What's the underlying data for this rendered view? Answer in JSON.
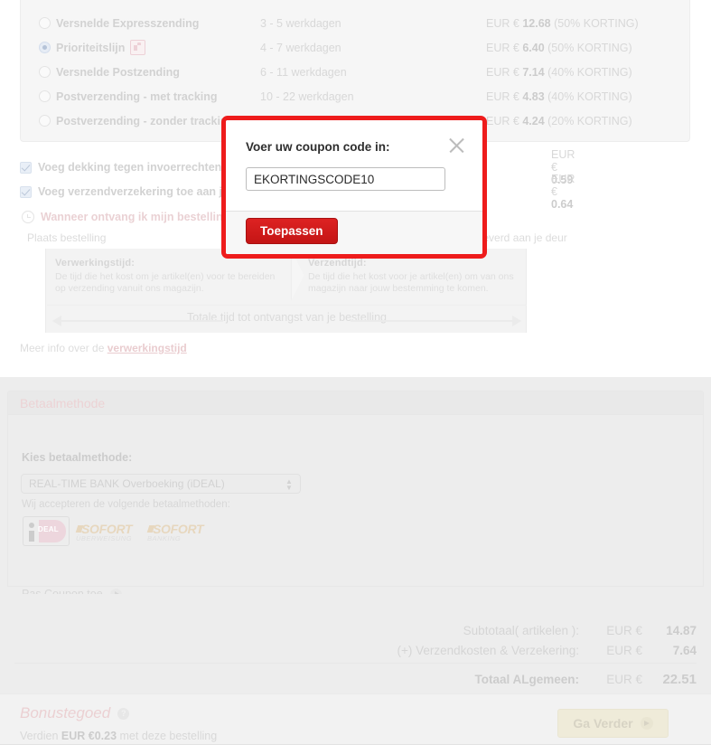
{
  "shipping": {
    "options": [
      {
        "name": "Versnelde Expresszending",
        "selected": false,
        "badge": false,
        "days": "3 - 5 werkdagen",
        "currency": "EUR €",
        "price": "12.68",
        "discount": "(50% KORTING)"
      },
      {
        "name": "Prioriteitslijn",
        "selected": true,
        "badge": true,
        "days": "4 - 7 werkdagen",
        "currency": "EUR €",
        "price": "6.40",
        "discount": "(50% KORTING)"
      },
      {
        "name": "Versnelde Postzending",
        "selected": false,
        "badge": false,
        "days": "6 - 11 werkdagen",
        "currency": "EUR €",
        "price": "7.14",
        "discount": "(40% KORTING)"
      },
      {
        "name": "Postverzending - met tracking",
        "selected": false,
        "badge": false,
        "days": "10 - 22 werkdagen",
        "currency": "EUR €",
        "price": "4.83",
        "discount": "(40% KORTING)"
      },
      {
        "name": "Postverzending - zonder tracking",
        "selected": false,
        "badge": false,
        "days": "",
        "currency": "EUR €",
        "price": "4.24",
        "discount": "(20% KORTING)"
      }
    ],
    "addons": [
      {
        "label": "Voeg dekking tegen invoerrechten &",
        "checked": true,
        "currency": "EUR €",
        "price": "0.59"
      },
      {
        "label": "Voeg verzendverzekering toe aan je",
        "checked": true,
        "currency": "EUR €",
        "price": "0.64"
      }
    ],
    "when_question": "Wanneer ontvang ik mijn bestelling?"
  },
  "timeline": {
    "start_label": "Plaats bestelling",
    "end_label": "eleverd aan je deur",
    "processing": {
      "title": "Verwerkingstijd:",
      "text": "De tijd die het kost om je artikel(en) voor te bereiden op verzending vanuit ons magazijn."
    },
    "shipping_time": {
      "title": "Verzendtijd:",
      "text": "De tijd die het kost voor je artikel(en) om van ons magazijn naar jouw bestemming te komen."
    },
    "total_label": "Totale tijd tot ontvangst van je bestelling",
    "more_info_prefix": "Meer info over de ",
    "more_info_link": "verwerkingstijd"
  },
  "payment": {
    "section_title": "Betaalmethode",
    "choose_label": "Kies betaalmethode:",
    "selected_method": "REAL-TIME BANK Overboeking (iDEAL)",
    "accepted_label": "Wij accepteren de volgende betaalmethoden:",
    "logos": [
      {
        "name": "ideal",
        "text": "DEAL"
      },
      {
        "name": "sofort-uberweisung",
        "big": "SOFORT",
        "small": "ÜBERWEISUNG"
      },
      {
        "name": "sofort-banking",
        "big": "SOFORT",
        "small": "BANKING"
      }
    ],
    "coupon_link": "Pas Coupon toe"
  },
  "totals": {
    "rows": [
      {
        "label": "Subtotaal( artikelen ):",
        "currency": "EUR €",
        "amount": "14.87"
      },
      {
        "label": "(+) Verzendkosten & Verzekering:",
        "currency": "EUR €",
        "amount": "7.64"
      }
    ],
    "grand": {
      "label": "Totaal ALgemeen:",
      "currency": "EUR €",
      "amount": "22.51"
    }
  },
  "bonus": {
    "title": "Bonustegoed",
    "help": "?",
    "sub_prefix": "Verdien ",
    "sub_amount": "EUR €0.23",
    "sub_suffix": " met deze bestelling",
    "continue_label": "Ga Verder"
  },
  "modal": {
    "title": "Voer uw coupon code in:",
    "input_value": "EKORTINGSCODE10",
    "input_placeholder": "",
    "apply_label": "Toepassen",
    "close_icon": "close-icon",
    "border_color": "#ee1c1c"
  }
}
